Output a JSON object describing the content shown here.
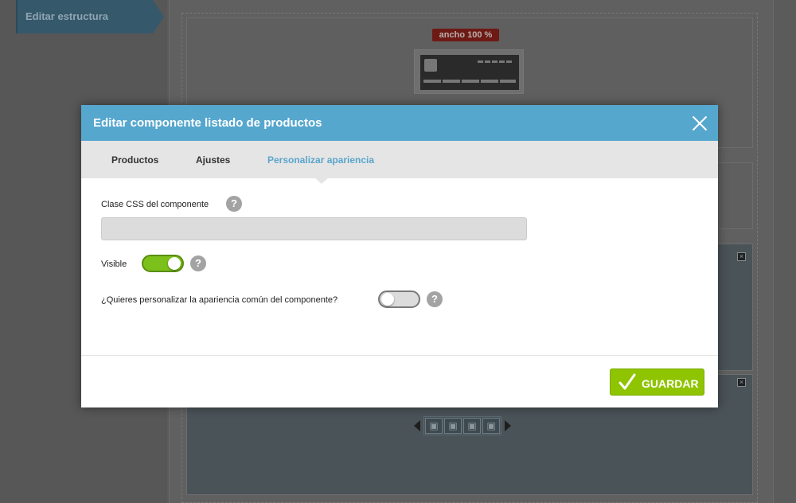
{
  "background": {
    "sidebar_tab_label": "Editar estructura",
    "width_badge": "ancho 100 %",
    "pager_dots": [
      "▣",
      "▣",
      "▣",
      "▣"
    ]
  },
  "modal": {
    "title": "Editar componente listado de productos",
    "tabs": [
      {
        "label": "Productos",
        "active": false
      },
      {
        "label": "Ajustes",
        "active": false
      },
      {
        "label": "Personalizar apariencia",
        "active": true
      }
    ],
    "css_class_label": "Clase CSS del componente",
    "css_class_value": "",
    "visible_label": "Visible",
    "visible_on": true,
    "customize_label": "¿Quieres personalizar la apariencia común del componente?",
    "customize_on": false,
    "help_glyph": "?",
    "save_label": "GUARDAR"
  },
  "colors": {
    "header": "#56a7ce",
    "active_tab": "#5aa5cc",
    "toggle_on": "#7cc01c",
    "save": "#8fc400",
    "badge": "#6e1a14"
  }
}
